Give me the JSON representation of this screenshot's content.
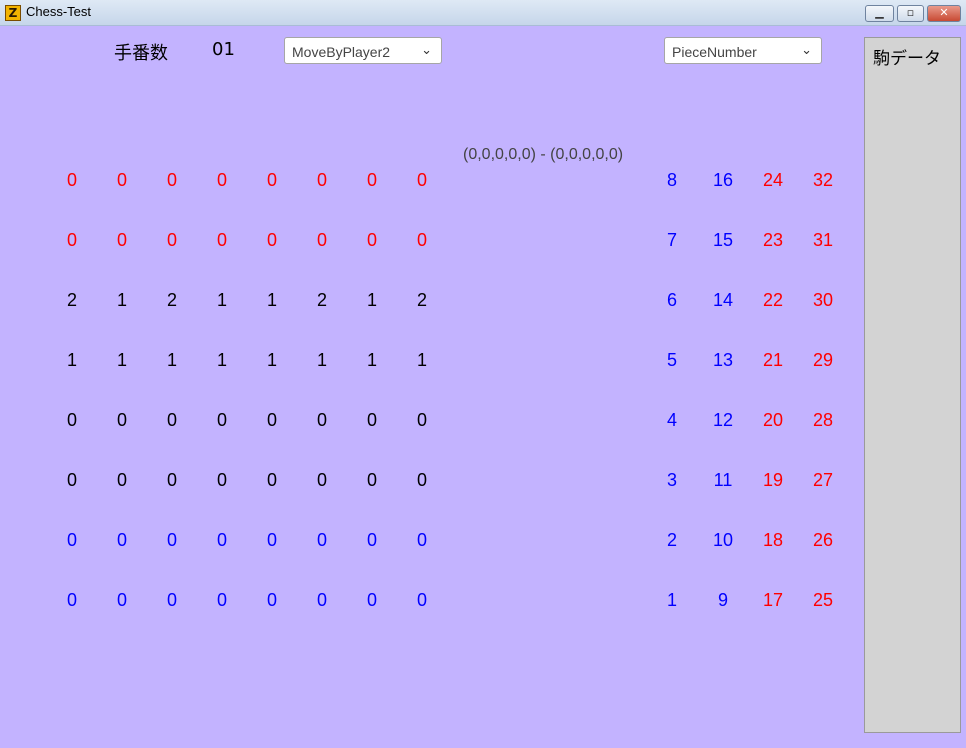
{
  "window": {
    "title": "Chess-Test",
    "app_icon": "Z"
  },
  "controls": {
    "turn_label": "手番数",
    "turn_value": "01",
    "mode_select": "MoveByPlayer2",
    "view_select": "PieceNumber",
    "chevron": "⌄"
  },
  "side_panel": {
    "title": "駒データ"
  },
  "coords_text": "(0,0,0,0,0) - (0,0,0,0,0)",
  "colors": {
    "red": "#ff0000",
    "black": "#000000",
    "blue": "#0000ff",
    "background": "#c3b3ff"
  },
  "board": {
    "rows": [
      {
        "color": "red",
        "cells": [
          "0",
          "0",
          "0",
          "0",
          "0",
          "0",
          "0",
          "0"
        ]
      },
      {
        "color": "red",
        "cells": [
          "0",
          "0",
          "0",
          "0",
          "0",
          "0",
          "0",
          "0"
        ]
      },
      {
        "color": "black",
        "cells": [
          "2",
          "1",
          "2",
          "1",
          "1",
          "2",
          "1",
          "2"
        ]
      },
      {
        "color": "black",
        "cells": [
          "1",
          "1",
          "1",
          "1",
          "1",
          "1",
          "1",
          "1"
        ]
      },
      {
        "color": "black",
        "cells": [
          "0",
          "0",
          "0",
          "0",
          "0",
          "0",
          "0",
          "0"
        ]
      },
      {
        "color": "black",
        "cells": [
          "0",
          "0",
          "0",
          "0",
          "0",
          "0",
          "0",
          "0"
        ]
      },
      {
        "color": "blue",
        "cells": [
          "0",
          "0",
          "0",
          "0",
          "0",
          "0",
          "0",
          "0"
        ]
      },
      {
        "color": "blue",
        "cells": [
          "0",
          "0",
          "0",
          "0",
          "0",
          "0",
          "0",
          "0"
        ]
      }
    ]
  },
  "piece_numbers": {
    "rows": [
      {
        "blue": [
          "8",
          "16"
        ],
        "red": [
          "24",
          "32"
        ]
      },
      {
        "blue": [
          "7",
          "15"
        ],
        "red": [
          "23",
          "31"
        ]
      },
      {
        "blue": [
          "6",
          "14"
        ],
        "red": [
          "22",
          "30"
        ]
      },
      {
        "blue": [
          "5",
          "13"
        ],
        "red": [
          "21",
          "29"
        ]
      },
      {
        "blue": [
          "4",
          "12"
        ],
        "red": [
          "20",
          "28"
        ]
      },
      {
        "blue": [
          "3",
          "11"
        ],
        "red": [
          "19",
          "27"
        ]
      },
      {
        "blue": [
          "2",
          "10"
        ],
        "red": [
          "18",
          "26"
        ]
      },
      {
        "blue": [
          "1",
          "9"
        ],
        "red": [
          "17",
          "25"
        ]
      }
    ]
  }
}
